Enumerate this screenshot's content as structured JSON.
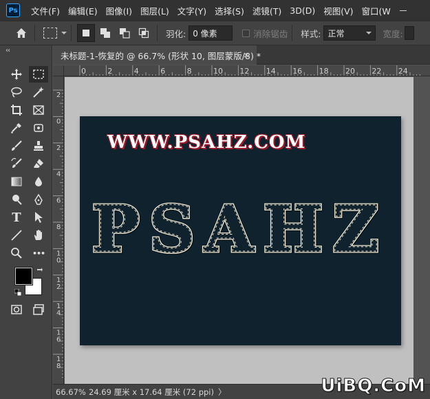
{
  "app": {
    "logo_text": "Ps"
  },
  "menu": [
    "文件(F)",
    "编辑(E)",
    "图像(I)",
    "图层(L)",
    "文字(Y)",
    "选择(S)",
    "滤镜(T)",
    "3D(D)",
    "视图(V)",
    "窗口(W"
  ],
  "options": {
    "feather_label": "羽化:",
    "feather_value": "0 像素",
    "antialias_label": "消除锯齿",
    "style_label": "样式:",
    "style_value": "正常",
    "width_label": "宽度:"
  },
  "tools": {
    "collapse": "‹‹",
    "icons": [
      "move-tool-icon",
      "rect-marquee-tool-icon",
      "lasso-tool-icon",
      "magic-wand-tool-icon",
      "crop-tool-icon",
      "frame-tool-icon",
      "eyedropper-tool-icon",
      "patch-tool-icon",
      "brush-tool-icon",
      "clone-stamp-tool-icon",
      "history-brush-tool-icon",
      "eraser-tool-icon",
      "gradient-tool-icon",
      "blur-tool-icon",
      "dodge-tool-icon",
      "pen-tool-icon",
      "type-tool-icon",
      "path-select-tool-icon",
      "line-tool-icon",
      "hand-tool-icon",
      "zoom-tool-icon",
      "more-tools-icon"
    ],
    "type_glyph": "T",
    "more_glyph": "•••"
  },
  "colors": {
    "foreground": "#000000",
    "background": "#ffffff",
    "canvas": "#10222d",
    "accent": "#31a8ff"
  },
  "document": {
    "tab_title": "未标题-1-恢复的 @ 66.7% (形状 10, 图层蒙版/8) *",
    "close_glyph": "×"
  },
  "ruler": {
    "h_labels": [
      "0",
      "2",
      "4",
      "6",
      "8",
      "10",
      "12",
      "14",
      "16",
      "18",
      "20",
      "22",
      "24"
    ],
    "v_labels": [
      "2",
      "0",
      "2",
      "4",
      "6",
      "8",
      "1 0",
      "1 2",
      "1 4",
      "1 6",
      "1 8"
    ]
  },
  "canvas_text": {
    "url": "WWW.PSAHZ.COM",
    "title": "PSAHZ"
  },
  "status": {
    "zoom": "66.67%",
    "info": "24.69 厘米 x 17.64 厘米 (72 ppi)",
    "arrow": "〉"
  },
  "watermark": "UiBQ.CoM"
}
